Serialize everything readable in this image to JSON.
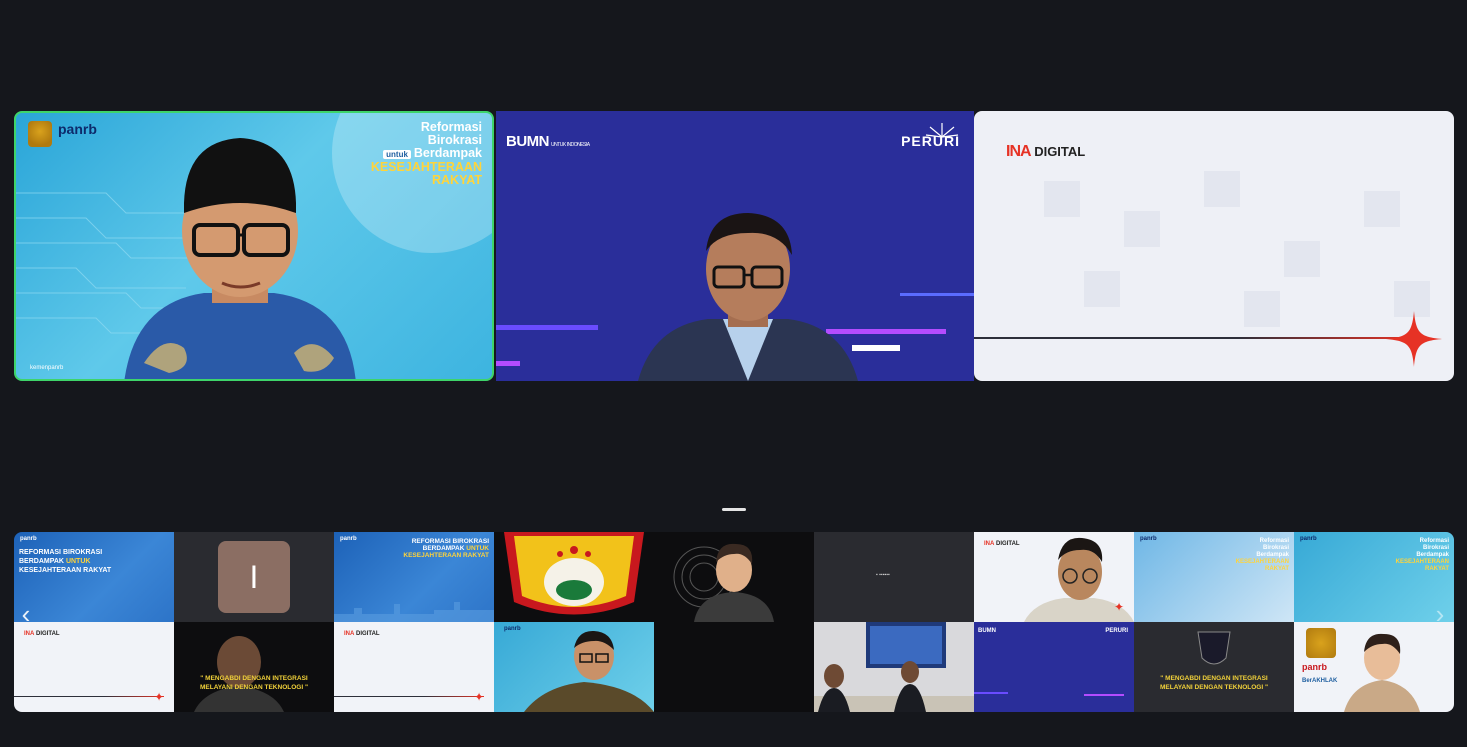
{
  "speakers": [
    {
      "logo_text": "panrb",
      "slogan_line1": "Reformasi",
      "slogan_line2": "Birokrasi",
      "slogan_tag": "untuk",
      "slogan_line3": "Berdampak",
      "slogan_line4": "KESEJAHTERAAN",
      "slogan_line5": "RAKYAT",
      "social_text": "kemenpanrb",
      "active_border_color": "#3ed46a"
    },
    {
      "logo_left": "BUMN",
      "logo_left_sub": "UNTUK INDONESIA",
      "logo_right": "PERURI"
    },
    {
      "logo_ina": "INA",
      "logo_digital": "DIGITAL"
    }
  ],
  "gallery": {
    "row1": [
      {
        "type": "slide",
        "logo": "panrb",
        "text_line1": "REFORMASI BIROKRASI",
        "text_line2": "BERDAMPAK",
        "text_tag": "UNTUK",
        "text_line3": "KESEJAHTERAAN RAKYAT"
      },
      {
        "type": "avatar",
        "initial": "I",
        "color": "#8b6e63"
      },
      {
        "type": "slide",
        "logo": "panrb",
        "text_line1": "REFORMASI BIROKRASI",
        "text_line2": "BERDAMPAK",
        "text_tag": "UNTUK",
        "text_line3": "KESEJAHTERAAN RAKYAT"
      },
      {
        "type": "emblem"
      },
      {
        "type": "animated-avatar"
      },
      {
        "type": "dark-logo"
      },
      {
        "type": "video",
        "logo_ina": "INA",
        "logo_digital": "DIGITAL"
      },
      {
        "type": "slide",
        "logo": "panrb",
        "text_right_1": "Reformasi",
        "text_right_2": "Birokrasi",
        "text_right_3": "Berdampak",
        "text_right_4": "KESEJAHTERAAN",
        "text_right_5": "RAKYAT"
      },
      {
        "type": "slide",
        "logo": "panrb",
        "text_right_1": "Reformasi",
        "text_right_2": "Birokrasi",
        "text_right_3": "Berdampak",
        "text_right_4": "KESEJAHTERAAN",
        "text_right_5": "RAKYAT"
      }
    ],
    "row2": [
      {
        "type": "ina",
        "logo_ina": "INA",
        "logo_digital": "DIGITAL"
      },
      {
        "type": "quote-video",
        "quote_line1": "\" MENGABDI DENGAN INTEGRASI",
        "quote_line2": "MELAYANI DENGAN TEKNOLOGI \""
      },
      {
        "type": "ina",
        "logo_ina": "INA",
        "logo_digital": "DIGITAL"
      },
      {
        "type": "video",
        "logo": "panrb"
      },
      {
        "type": "black"
      },
      {
        "type": "video-room"
      },
      {
        "type": "peruri",
        "logo_left": "BUMN",
        "logo_right": "PERURI"
      },
      {
        "type": "quote-video",
        "quote_line1": "\" MENGABDI DENGAN INTEGRASI",
        "quote_line2": "MELAYANI DENGAN TEKNOLOGI \""
      },
      {
        "type": "panrb-avatar",
        "logo": "panrb",
        "brand": "BerAKHLAK"
      }
    ]
  },
  "colors": {
    "background": "#15171c",
    "accent_red": "#e63225",
    "peruri_blue": "#2a2e9a"
  }
}
